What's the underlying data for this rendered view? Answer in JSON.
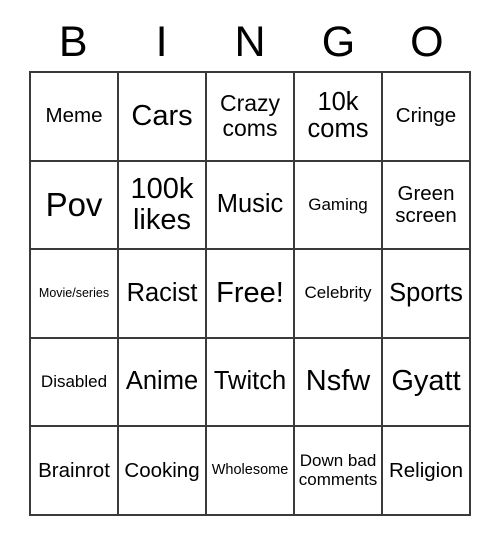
{
  "card": {
    "title": "BINGO",
    "header_letters": [
      "B",
      "I",
      "N",
      "G",
      "O"
    ],
    "grid_size": "5x5",
    "border_color": "#3a3a3a",
    "background_color": "#ffffff",
    "text_color": "#000000",
    "free_space_label": "Free!",
    "rows": [
      {
        "cells": [
          {
            "label": "Meme",
            "size": "m"
          },
          {
            "label": "Cars",
            "size": "xl"
          },
          {
            "label": "Crazy coms",
            "size": "ml"
          },
          {
            "label": "10k coms",
            "size": "l"
          },
          {
            "label": "Cringe",
            "size": "m"
          }
        ]
      },
      {
        "cells": [
          {
            "label": "Pov",
            "size": "xxl"
          },
          {
            "label": "100k likes",
            "size": "xl"
          },
          {
            "label": "Music",
            "size": "l"
          },
          {
            "label": "Gaming",
            "size": "sm"
          },
          {
            "label": "Green screen",
            "size": "m"
          }
        ]
      },
      {
        "cells": [
          {
            "label": "Movie/series",
            "size": "xs"
          },
          {
            "label": "Racist",
            "size": "l"
          },
          {
            "label": "Free!",
            "size": "xl"
          },
          {
            "label": "Celebrity",
            "size": "sm"
          },
          {
            "label": "Sports",
            "size": "l"
          }
        ]
      },
      {
        "cells": [
          {
            "label": "Disabled",
            "size": "sm"
          },
          {
            "label": "Anime",
            "size": "l"
          },
          {
            "label": "Twitch",
            "size": "l"
          },
          {
            "label": "Nsfw",
            "size": "xl"
          },
          {
            "label": "Gyatt",
            "size": "xl"
          }
        ]
      },
      {
        "cells": [
          {
            "label": "Brainrot",
            "size": "m"
          },
          {
            "label": "Cooking",
            "size": "m"
          },
          {
            "label": "Wholesome",
            "size": "s"
          },
          {
            "label": "Down bad comments",
            "size": "sm"
          },
          {
            "label": "Religion",
            "size": "m"
          }
        ]
      }
    ]
  }
}
